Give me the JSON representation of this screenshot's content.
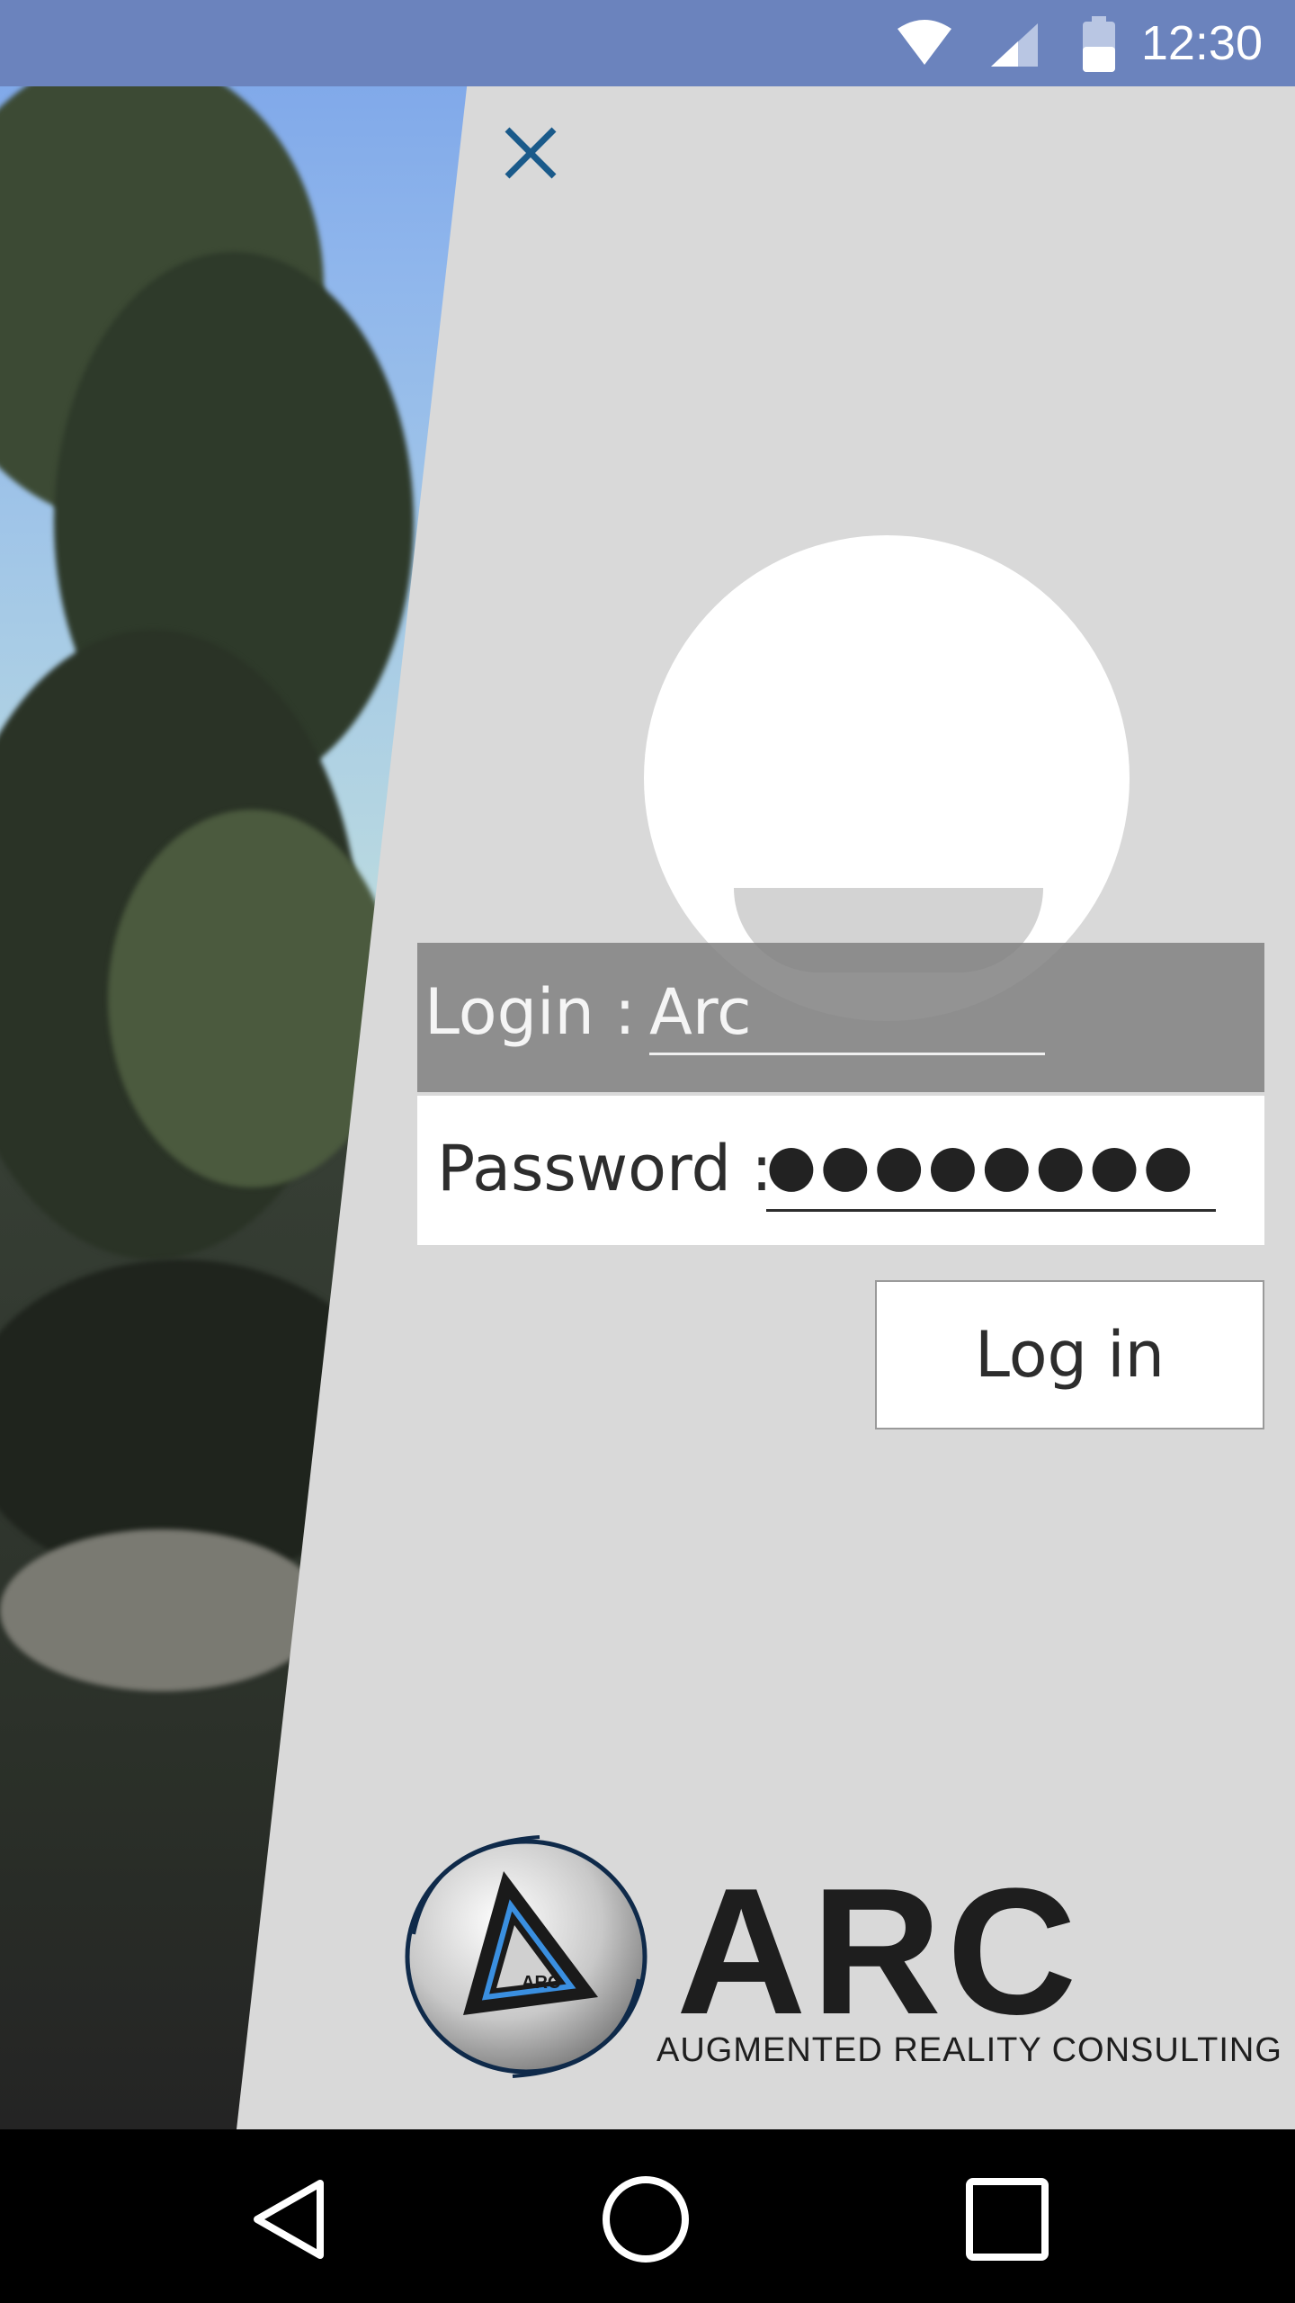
{
  "status_bar": {
    "time": "12:30",
    "icons": [
      "wifi-icon",
      "cell-signal-icon",
      "battery-icon"
    ]
  },
  "colors": {
    "status_bar": "#6b83bd",
    "panel": "#d9d9d9",
    "close_icon": "#1a5a8a",
    "logo_accent": "#3a8fe0"
  },
  "login_form": {
    "close_icon": "close-icon",
    "login_label": "Login :",
    "login_value": "Arc",
    "password_label": "Password :",
    "password_value": "●●●●●●●●",
    "submit_label": "Log in"
  },
  "logo": {
    "wordmark": "ARC",
    "badge_text": "ARC",
    "tagline": "AUGMENTED REALITY CONSULTING"
  },
  "nav_bar": {
    "icons": [
      "back-icon",
      "home-icon",
      "recents-icon"
    ]
  }
}
